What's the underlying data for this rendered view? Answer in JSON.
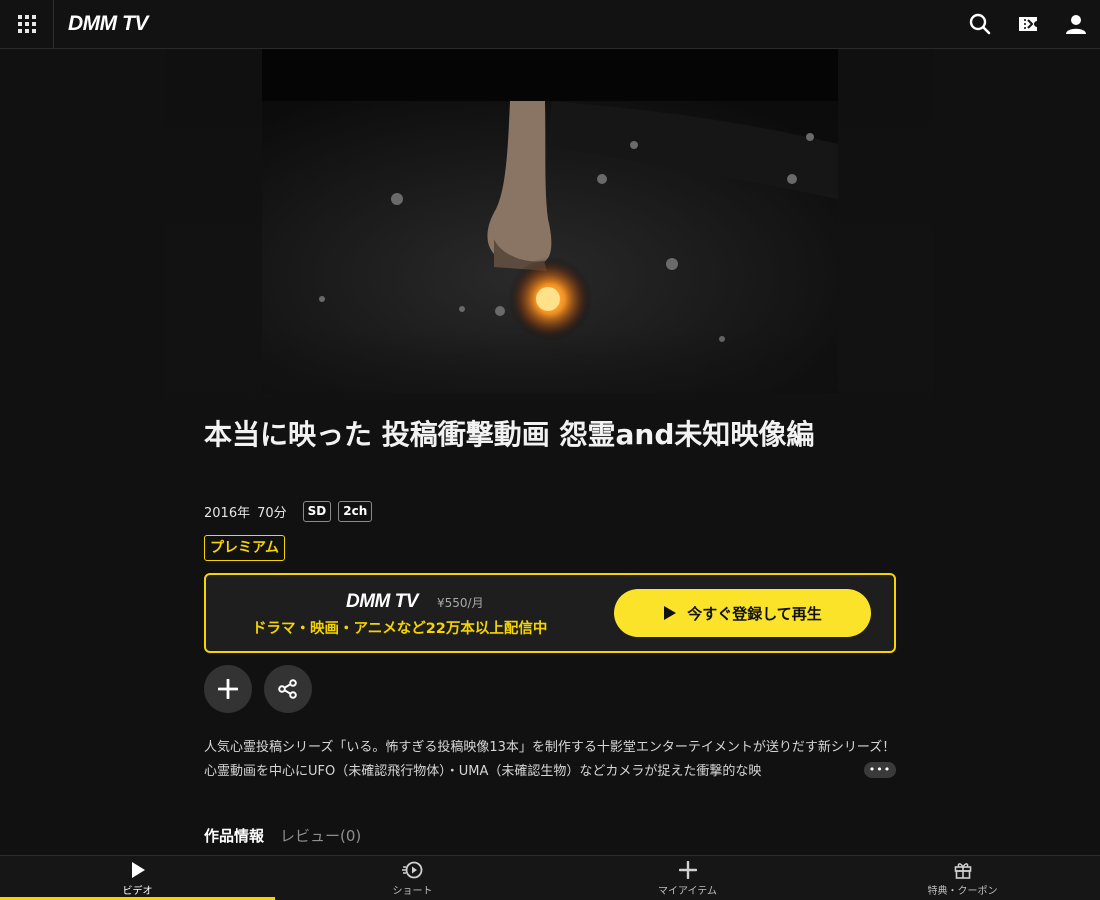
{
  "header": {
    "logo": "DMM TV",
    "icons": [
      "grid-menu-icon",
      "search-icon",
      "ticket-icon",
      "user-icon"
    ]
  },
  "video": {
    "title": "本当に映った 投稿衝撃動画 怨霊and未知映像編",
    "year": "2016年",
    "duration": "70分",
    "quality": "SD",
    "audio": "2ch",
    "badge": "プレミアム"
  },
  "promo": {
    "logo": "DMM TV",
    "price": "¥550/月",
    "copy": "ドラマ・映画・アニメなど22万本以上配信中",
    "cta": "今すぐ登録して再生"
  },
  "actions": [
    "add-icon",
    "share-icon"
  ],
  "description": {
    "text": "人気心霊投稿シリーズ「いる。怖すぎる投稿映像13本」を制作する十影堂エンターテイメントが送りだす新シリーズ！心霊動画を中心にUFO（未確認飛行物体）・UMA（未確認生物）などカメラが捉えた衝撃的な映",
    "more": "•••"
  },
  "tabs": [
    {
      "label": "作品情報",
      "active": true
    },
    {
      "label": "レビュー(0)",
      "active": false
    }
  ],
  "bottom_nav": [
    {
      "label": "ビデオ",
      "icon": "play-icon",
      "active": true
    },
    {
      "label": "ショート",
      "icon": "short-play-icon",
      "active": false
    },
    {
      "label": "マイアイテム",
      "icon": "plus-icon",
      "active": false
    },
    {
      "label": "特典・クーポン",
      "icon": "gift-icon",
      "active": false
    }
  ],
  "colors": {
    "accent": "#f5d400",
    "button": "#fbe32a",
    "background": "#111111"
  }
}
